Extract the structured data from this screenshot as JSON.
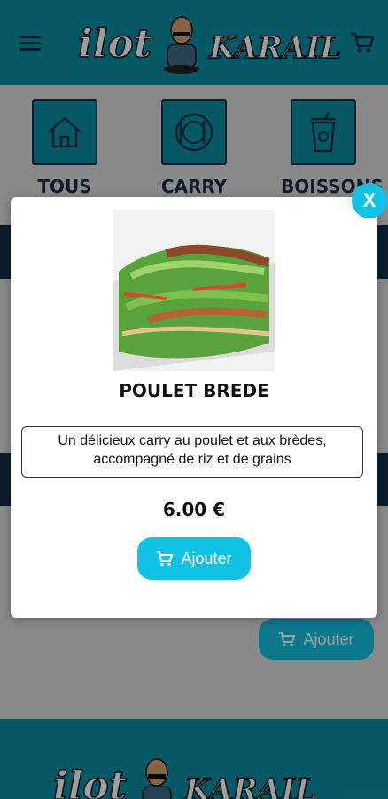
{
  "header": {
    "logo_left": "ilot",
    "logo_right": "KARAIL"
  },
  "categories": [
    {
      "label": "TOUS",
      "icon": "home-icon"
    },
    {
      "label": "CARRY",
      "icon": "plate-icon"
    },
    {
      "label": "BOISSONS",
      "icon": "drink-icon"
    }
  ],
  "background": {
    "add_label": "Ajouter"
  },
  "modal": {
    "close_label": "X",
    "name": "POULET BREDE",
    "description": "Un délicieux carry au poulet et aux brèdes, accompagné de riz et de grains",
    "price": "6.00 €",
    "add_label": "Ajouter"
  },
  "footer": {
    "logo_left": "ilot",
    "logo_right": "KARAIL"
  },
  "colors": {
    "teal": "#0b8fa6",
    "accent": "#12c2e4",
    "navy": "#12304a"
  }
}
